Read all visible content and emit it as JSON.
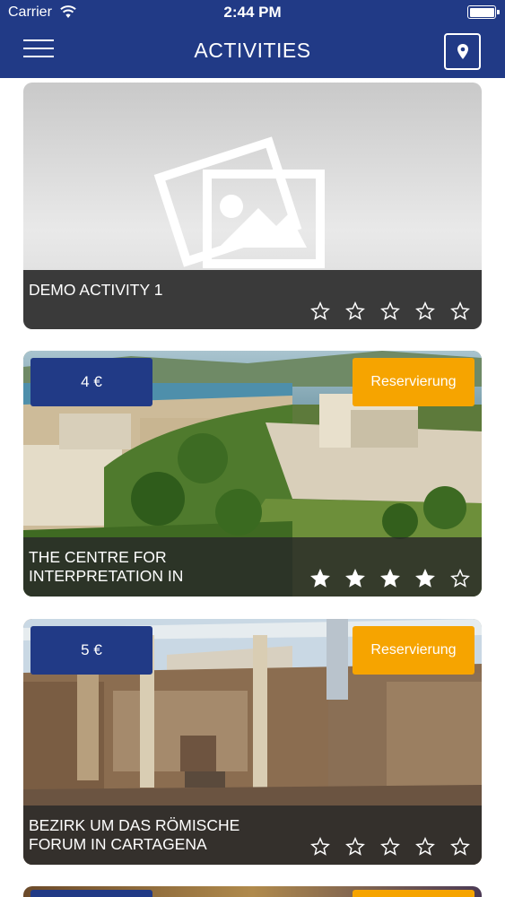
{
  "status_bar": {
    "carrier": "Carrier",
    "time": "2:44 PM"
  },
  "nav": {
    "title": "ACTIVITIES",
    "menu_icon": "hamburger-icon",
    "map_icon": "map-pin-icon"
  },
  "colors": {
    "nav_bg": "#213a86",
    "price_bg": "#213a86",
    "reserve_bg": "#f6a400"
  },
  "activities": [
    {
      "title": "DEMO ACTIVITY 1",
      "price": "",
      "reserve_label": "",
      "image": "placeholder-image-icon",
      "rating": 0,
      "rating_max": 5
    },
    {
      "title": "THE CENTRE FOR INTERPRETATION IN",
      "price": "4 €",
      "reserve_label": "Reservierung",
      "image": "cartagena-castle-aerial-photo",
      "rating": 4,
      "rating_max": 5
    },
    {
      "title": "BEZIRK UM DAS RÖMISCHE FORUM IN CARTAGENA",
      "price": "5 €",
      "reserve_label": "Reservierung",
      "image": "roman-forum-ruins-photo",
      "rating": 0,
      "rating_max": 5
    }
  ]
}
